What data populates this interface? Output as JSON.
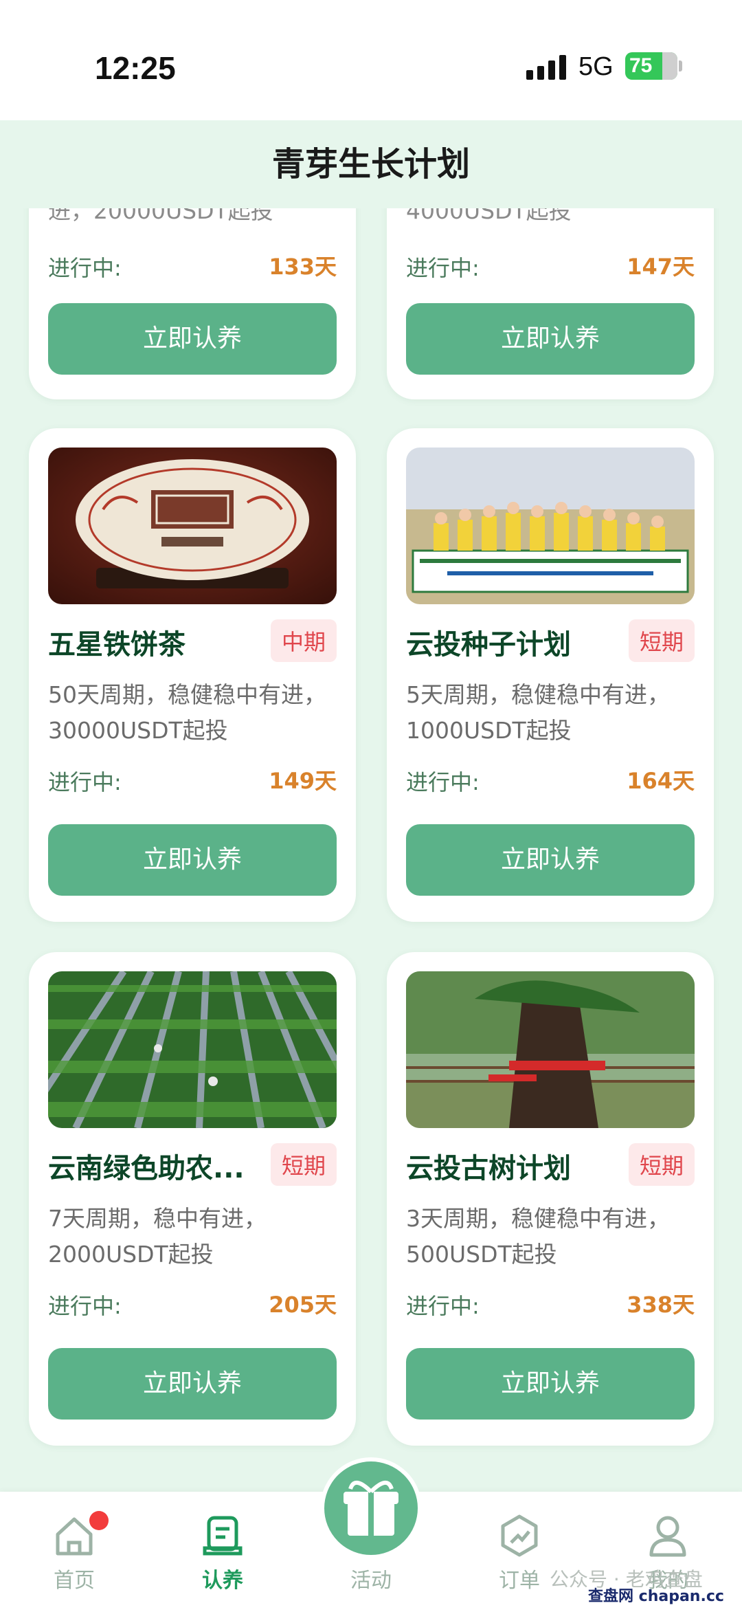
{
  "status_bar": {
    "time": "12:25",
    "network": "5G",
    "battery": "75"
  },
  "header": {
    "title": "青芽生长计划"
  },
  "partial_cards": [
    {
      "description": "进，20000USDT起投",
      "status_label": "进行中:",
      "days": "133天",
      "button_label": "立即认养"
    },
    {
      "description": "4000USDT起投",
      "status_label": "进行中:",
      "days": "147天",
      "button_label": "立即认养"
    }
  ],
  "cards": [
    {
      "title": "五星铁饼茶",
      "tag": "中期",
      "description": "50天周期，稳健稳中有进，30000USDT起投",
      "status_label": "进行中:",
      "days": "149天",
      "button_label": "立即认养",
      "image": "tea-cake-photo"
    },
    {
      "title": "云投种子计划",
      "tag": "短期",
      "description": "5天周期，稳健稳中有进，1000USDT起投",
      "status_label": "进行中:",
      "days": "164天",
      "button_label": "立即认养",
      "image": "group-photo"
    },
    {
      "title": "云南绿色助农...",
      "tag": "短期",
      "description": "7天周期，稳中有进，2000USDT起投",
      "status_label": "进行中:",
      "days": "205天",
      "button_label": "立即认养",
      "image": "tea-field-photo"
    },
    {
      "title": "云投古树计划",
      "tag": "短期",
      "description": "3天周期，稳健稳中有进，500USDT起投",
      "status_label": "进行中:",
      "days": "338天",
      "button_label": "立即认养",
      "image": "ancient-tree-photo"
    }
  ],
  "bottom_nav": {
    "items": [
      {
        "label": "首页",
        "icon": "home-icon"
      },
      {
        "label": "认养",
        "icon": "adopt-icon"
      },
      {
        "label": "活动",
        "icon": "gift-icon"
      },
      {
        "label": "订单",
        "icon": "order-icon"
      },
      {
        "label": "我的",
        "icon": "profile-icon"
      }
    ],
    "active": "认养"
  },
  "watermark": {
    "text": "公众号 · 老鸡查盘",
    "site": "查盘网 chapan.cc"
  }
}
